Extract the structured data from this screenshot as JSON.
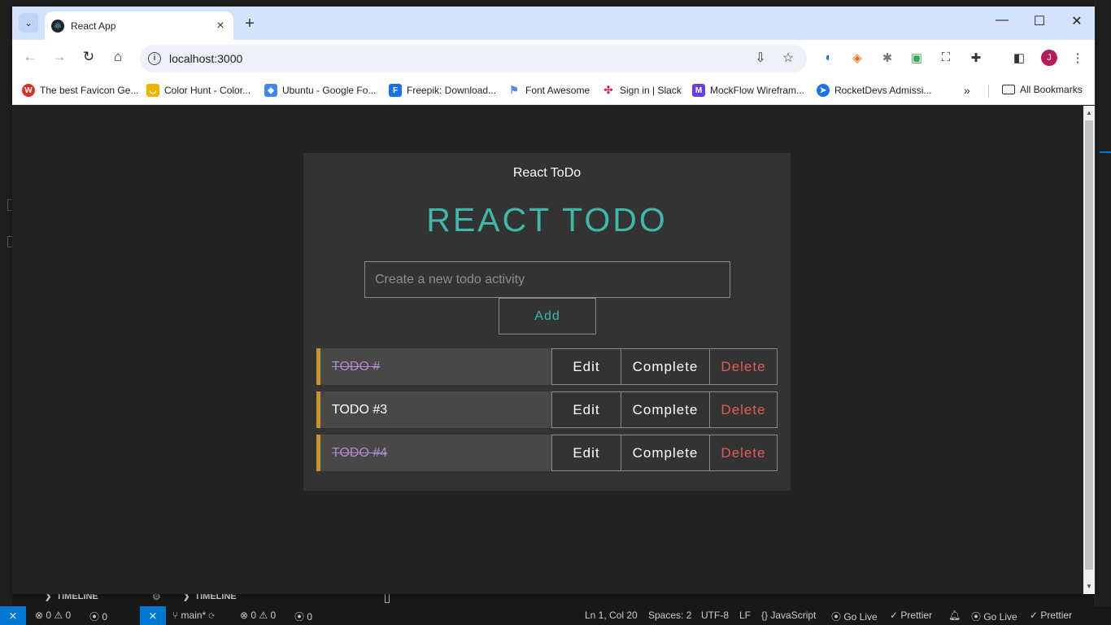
{
  "browser": {
    "tab_title": "React App",
    "url": "localhost:3000",
    "bookmarks": [
      {
        "label": "The best Favicon Ge...",
        "icon": "favicon-generator-icon",
        "color": "#d93025"
      },
      {
        "label": "Color Hunt - Color...",
        "icon": "color-hunt-icon",
        "color": "#f0b400"
      },
      {
        "label": "Ubuntu - Google Fo...",
        "icon": "google-fonts-icon",
        "color": "#4285f4"
      },
      {
        "label": "Freepik: Download...",
        "icon": "freepik-icon",
        "color": "#1273eb"
      },
      {
        "label": "Font Awesome",
        "icon": "flag-icon",
        "color": "#538dd7"
      },
      {
        "label": "Sign in | Slack",
        "icon": "slack-icon",
        "color": "#e01e5a"
      },
      {
        "label": "MockFlow Wirefram...",
        "icon": "mockflow-icon",
        "color": "#6a3de8"
      },
      {
        "label": "RocketDevs Admissi...",
        "icon": "rocketdevs-icon",
        "color": "#1a73e8"
      }
    ],
    "all_bookmarks": "All Bookmarks",
    "avatar_initial": "J"
  },
  "app": {
    "page_header": "React ToDo",
    "heading": "REACT TODO",
    "input_placeholder": "Create a new todo activity",
    "add_label": "Add",
    "todos": [
      {
        "text": "TODO #",
        "completed": true
      },
      {
        "text": "TODO #3",
        "completed": false
      },
      {
        "text": "TODO #4",
        "completed": true
      }
    ],
    "edit_label": "Edit",
    "complete_label": "Complete",
    "delete_label": "Delete"
  },
  "vscode": {
    "timeline_label": "TIMELINE",
    "status": {
      "left_errors": "0",
      "left_warnings": "0",
      "left_ports": "0",
      "branch": "main*",
      "errors": "0",
      "warnings": "0",
      "ports": "0",
      "cursor": "Ln 1, Col 20",
      "spaces": "Spaces: 2",
      "encoding": "UTF-8",
      "eol": "LF",
      "language": "JavaScript",
      "go_live": "Go Live",
      "prettier": "Prettier",
      "go_live_2": "Go Live",
      "prettier_2": "Prettier"
    }
  },
  "colors": {
    "accent": "#3fb8a9",
    "delete": "#e05b56",
    "todo_border": "#c9952b",
    "completed_text": "#b08ad0"
  }
}
